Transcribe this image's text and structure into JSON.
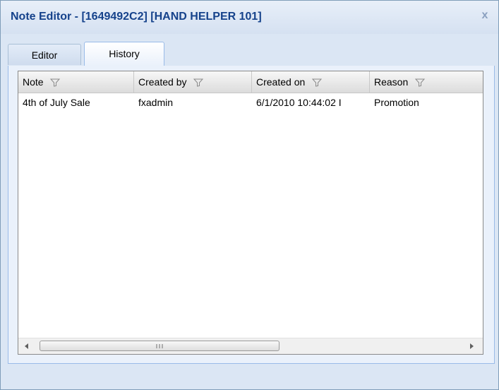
{
  "window": {
    "title": "Note Editor - [1649492C2] [HAND HELPER 101]",
    "close_symbol": "x"
  },
  "tabs": [
    {
      "label": "Editor",
      "active": false
    },
    {
      "label": "History",
      "active": true
    }
  ],
  "grid": {
    "columns": [
      "Note",
      "Created by",
      "Created on",
      "Reason"
    ],
    "rows": [
      {
        "note": "4th of July Sale",
        "created_by": "fxadmin",
        "created_on": "6/1/2010 10:44:02 I",
        "reason": "Promotion"
      }
    ]
  },
  "icons": {
    "filter": "filter-icon",
    "close": "close-icon",
    "scroll_left": "scroll-left-arrow-icon",
    "scroll_right": "scroll-right-arrow-icon"
  },
  "colors": {
    "title_text": "#15428b",
    "tab_border": "#99bbe8",
    "window_background": "#dbe6f4"
  }
}
